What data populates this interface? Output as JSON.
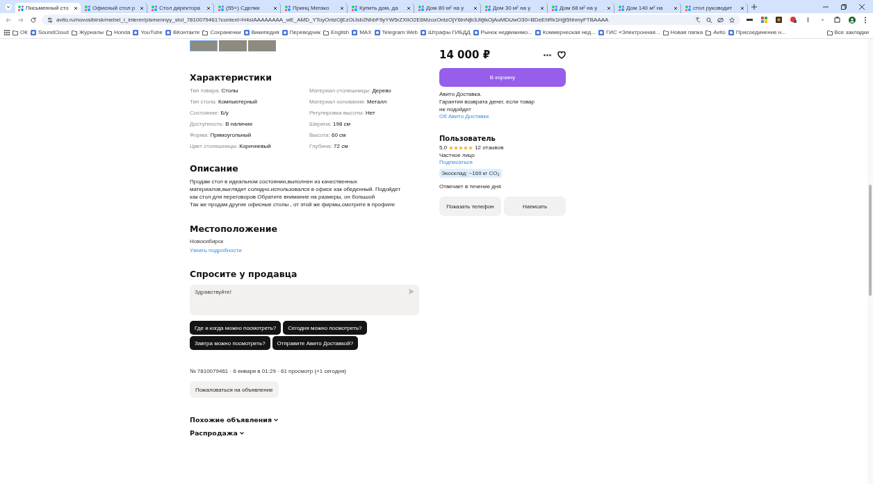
{
  "browser": {
    "tabs": [
      {
        "title": "Письменный сто",
        "selected": true
      },
      {
        "title": "Офисный стол р",
        "selected": false
      },
      {
        "title": "Стол директора",
        "selected": false
      },
      {
        "title": "(55+) Сделки",
        "selected": false
      },
      {
        "title": "Принц Мегако",
        "selected": false
      },
      {
        "title": "Купить дом, да",
        "selected": false
      },
      {
        "title": "Дом 80 м² на у",
        "selected": false
      },
      {
        "title": "Дом 30 м² на у",
        "selected": false
      },
      {
        "title": "Дом 68 м² на у",
        "selected": false
      },
      {
        "title": "Дом 140 м² на",
        "selected": false
      },
      {
        "title": "стол руководит",
        "selected": false
      }
    ],
    "address": "avito.ru/novosibirsk/mebel_i_interer/pismennyy_stol_7810079461?context=H4sIAAAAAAAA_wE_AMD_YToyOntzOjEzOiJsb2NhbF9yYW5rZXIiO2E6MzozOntzOjY6InNjb3JlIjtkOjAuMDUwO30=BDeEhRk1H|jt5hhmyFTBAAAA",
    "bookmarks": [
      {
        "label": "ОК",
        "kind": "folder"
      },
      {
        "label": "SoundCloud",
        "kind": "site"
      },
      {
        "label": "Журналы",
        "kind": "folder"
      },
      {
        "label": "Honda",
        "kind": "folder"
      },
      {
        "label": "YouTube",
        "kind": "site"
      },
      {
        "label": "ВКонтакте",
        "kind": "site"
      },
      {
        "label": "Сохраненки",
        "kind": "folder"
      },
      {
        "label": "Википедия",
        "kind": "site"
      },
      {
        "label": "Переводчик",
        "kind": "site"
      },
      {
        "label": "English",
        "kind": "folder"
      },
      {
        "label": "MAX",
        "kind": "site"
      },
      {
        "label": "Telegram Web",
        "kind": "site"
      },
      {
        "label": "Штрафы ГИБДД",
        "kind": "site"
      },
      {
        "label": "Рынок недвижимо...",
        "kind": "site"
      },
      {
        "label": "Коммерческая нед...",
        "kind": "site"
      },
      {
        "label": "ГИС «Электронная...",
        "kind": "site"
      },
      {
        "label": "Новая папка",
        "kind": "folder"
      },
      {
        "label": "Avito",
        "kind": "folder"
      },
      {
        "label": "Присоединение н...",
        "kind": "site"
      }
    ],
    "all_bookmarks": "Все закладки"
  },
  "gallery": [
    {
      "selected": true
    },
    {
      "selected": false
    },
    {
      "selected": false
    }
  ],
  "characteristics": {
    "title": "Характеристики",
    "items": [
      {
        "label": "Тип товара:",
        "value": "Столы"
      },
      {
        "label": "Тип стола:",
        "value": "Компьютерный"
      },
      {
        "label": "Состояние:",
        "value": "Б/у"
      },
      {
        "label": "Доступность:",
        "value": "В наличии"
      },
      {
        "label": "Форма:",
        "value": "Прямоугольный"
      },
      {
        "label": "Цвет столешницы:",
        "value": "Коричневый"
      },
      {
        "label": "Материал столешницы:",
        "value": "Дерево"
      },
      {
        "label": "Материал основания:",
        "value": "Металл"
      },
      {
        "label": "Регулировка высоты:",
        "value": "Нет"
      },
      {
        "label": "Ширина:",
        "value": "198 см"
      },
      {
        "label": "Высота:",
        "value": "60 см"
      },
      {
        "label": "Глубина:",
        "value": "72 см"
      }
    ]
  },
  "description": {
    "title": "Описание",
    "lines": [
      "Продам стол в идеальном состоянии,выполнен из качественных",
      "материалов,выглядит солидно.использовался в офисе как обеденный. Подойдет",
      "как стол для переговоров Обратите внимание на размеры, он большой",
      "Так же продам другие офисные столы , от этой же фирмы,смотрите в профиле"
    ]
  },
  "location": {
    "title": "Местоположение",
    "city": "Новосибирск",
    "link": "Узнать подробности"
  },
  "ask": {
    "title": "Спросите у продавца",
    "message": "Здравствуйте!",
    "chips": [
      "Где и когда можно посмотреть?",
      "Сегодня можно посмотреть?",
      "Завтра можно посмотреть?",
      "Отправите Авито Доставкой?"
    ]
  },
  "meta": "№ 7810079461 · 6 января в 01:29 · 61 просмотр (+1 сегодня)",
  "report_button": "Пожаловаться на объявление",
  "sections": [
    "Похожие объявления",
    "Распродажа"
  ],
  "price": "14 000 ₽",
  "cart_button": "В корзину",
  "delivery": {
    "lines": [
      "Авито Доставка.",
      "Гарантия возврата денег, если товар",
      "не подойдет"
    ],
    "link": "Об Авито Доставке"
  },
  "seller": {
    "title": "Пользователь",
    "rating": "5,0",
    "stars": 5,
    "reviews": "12 отзывов",
    "type": "Частное лицо",
    "subscribe": "Подписаться",
    "eco": "Экосклад: ~169 кг CO₂",
    "response": "Отвечает в течение дня"
  },
  "contact_buttons": [
    "Показать телефон",
    "Написать"
  ]
}
